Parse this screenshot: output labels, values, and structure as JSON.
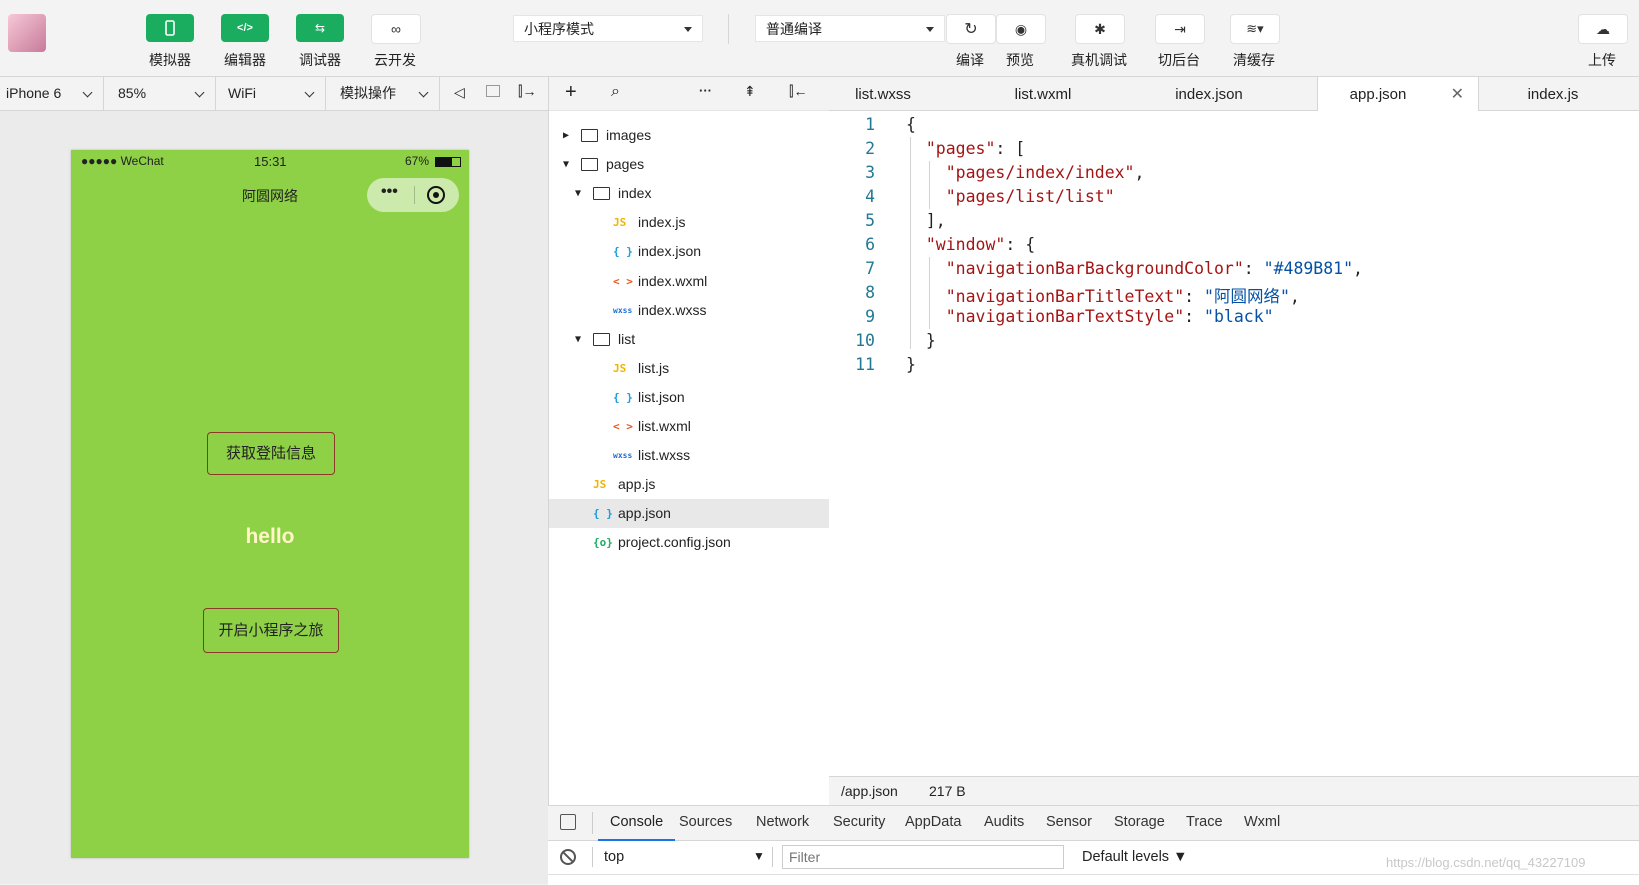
{
  "toolbar": {
    "simulator": "模拟器",
    "editor": "编辑器",
    "debugger": "调试器",
    "cloud": "云开发",
    "mode_select": "小程序模式",
    "compile_select": "普通编译",
    "compile": "编译",
    "preview": "预览",
    "remote_debug": "真机调试",
    "background": "切后台",
    "clear_cache": "清缓存",
    "upload": "上传"
  },
  "subbar": {
    "device": "iPhone 6",
    "zoom": "85%",
    "network": "WiFi",
    "simulate_ops": "模拟操作"
  },
  "phone": {
    "carrier": "●●●●● WeChat",
    "time": "15:31",
    "battery": "67%",
    "nav_title": "阿圆网络",
    "nav_bg_color": "#8ed046",
    "get_login_button": "获取登陆信息",
    "hello_text": "hello",
    "start_button": "开启小程序之旅"
  },
  "tree": {
    "items": [
      {
        "label": "images",
        "icon": "folder-icon"
      },
      {
        "label": "pages",
        "icon": "folder-open-icon"
      },
      {
        "label": "index",
        "icon": "folder-open-icon"
      },
      {
        "label": "index.js",
        "icon": "js-file-icon"
      },
      {
        "label": "index.json",
        "icon": "json-file-icon"
      },
      {
        "label": "index.wxml",
        "icon": "wxml-file-icon"
      },
      {
        "label": "index.wxss",
        "icon": "wxss-file-icon"
      },
      {
        "label": "list",
        "icon": "folder-open-icon"
      },
      {
        "label": "list.js",
        "icon": "js-file-icon"
      },
      {
        "label": "list.json",
        "icon": "json-file-icon"
      },
      {
        "label": "list.wxml",
        "icon": "wxml-file-icon"
      },
      {
        "label": "list.wxss",
        "icon": "wxss-file-icon"
      },
      {
        "label": "app.js",
        "icon": "js-file-icon"
      },
      {
        "label": "app.json",
        "icon": "json-file-icon"
      },
      {
        "label": "project.config.json",
        "icon": "config-file-icon"
      }
    ]
  },
  "tabs": [
    "list.wxss",
    "list.wxml",
    "index.json",
    "app.json",
    "index.js"
  ],
  "editor": {
    "line_numbers": [
      "1",
      "2",
      "3",
      "4",
      "5",
      "6",
      "7",
      "8",
      "9",
      "10",
      "11"
    ],
    "k_pages": "\"pages\"",
    "s_index": "\"pages/index/index\"",
    "s_list": "\"pages/list/list\"",
    "k_window": "\"window\"",
    "k_bgcolor": "\"navigationBarBackgroundColor\"",
    "s_bgcolor": "\"#489B81\"",
    "k_title": "\"navigationBarTitleText\"",
    "s_title": "\"阿圆网络\"",
    "k_style": "\"navigationBarTextStyle\"",
    "s_style": "\"black\""
  },
  "status": {
    "path": "/app.json",
    "size": "217 B"
  },
  "devtools": {
    "tabs": [
      "Console",
      "Sources",
      "Network",
      "Security",
      "AppData",
      "Audits",
      "Sensor",
      "Storage",
      "Trace",
      "Wxml"
    ],
    "context": "top",
    "filter_placeholder": "Filter",
    "levels": "Default levels ▼",
    "watermark": "https://blog.csdn.net/qq_43227109"
  },
  "colors": {
    "accent": "#1aad5f",
    "phone_bg": "#8ed046"
  }
}
